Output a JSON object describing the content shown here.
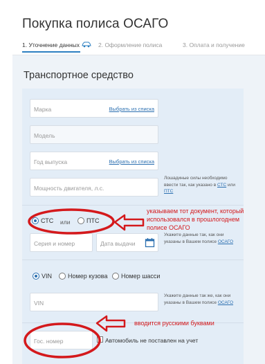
{
  "page": {
    "title": "Покупка полиса ОСАГО"
  },
  "steps": [
    {
      "label": "1. Уточнение данных"
    },
    {
      "label": "2. Оформление полиса"
    },
    {
      "label": "3. Оплата и получение"
    }
  ],
  "section": {
    "title": "Транспортное средство"
  },
  "fields": {
    "brand": {
      "placeholder": "Марка",
      "link": "Выбрать из списка"
    },
    "model": {
      "placeholder": "Модель"
    },
    "year": {
      "placeholder": "Год выпуска",
      "link": "Выбрать из списка"
    },
    "power": {
      "placeholder": "Мощность двигателя, л.с."
    },
    "series_number": {
      "placeholder": "Серия и номер"
    },
    "issue_date": {
      "placeholder": "Дата выдачи"
    },
    "vin": {
      "placeholder": "VIN"
    },
    "plate": {
      "placeholder": "Гос. номер"
    }
  },
  "notes": {
    "power_note": "Лошадиные силы необходимо ввести так, как указано в",
    "power_note_link1": "СТС",
    "power_note_or": "или",
    "power_note_link2": "ПТС",
    "doc_note": "Укажите данные так, как они указаны в Вашем полисе",
    "doc_note_link": "ОСАГО",
    "vin_note": "Укажите данные так же, как они указаны в Вашем полисе",
    "vin_note_link": "ОСАГО"
  },
  "doc_choice": {
    "opt1": "СТС",
    "or": "или",
    "opt2": "ПТС",
    "selected": "СТС"
  },
  "id_choice": {
    "opt1": "VIN",
    "opt2": "Номер кузова",
    "opt3": "Номер шасси",
    "selected": "VIN"
  },
  "checkbox": {
    "label": "Автомобиль не поставлен на учет",
    "checked": false
  },
  "annotations": {
    "doc": "указываем тот документ, который использовался в прошлогоднем полисе ОСАГО",
    "plate": "вводится русскими буквами"
  },
  "colors": {
    "accent": "#2b6fb0",
    "annotation": "#d4191c"
  }
}
